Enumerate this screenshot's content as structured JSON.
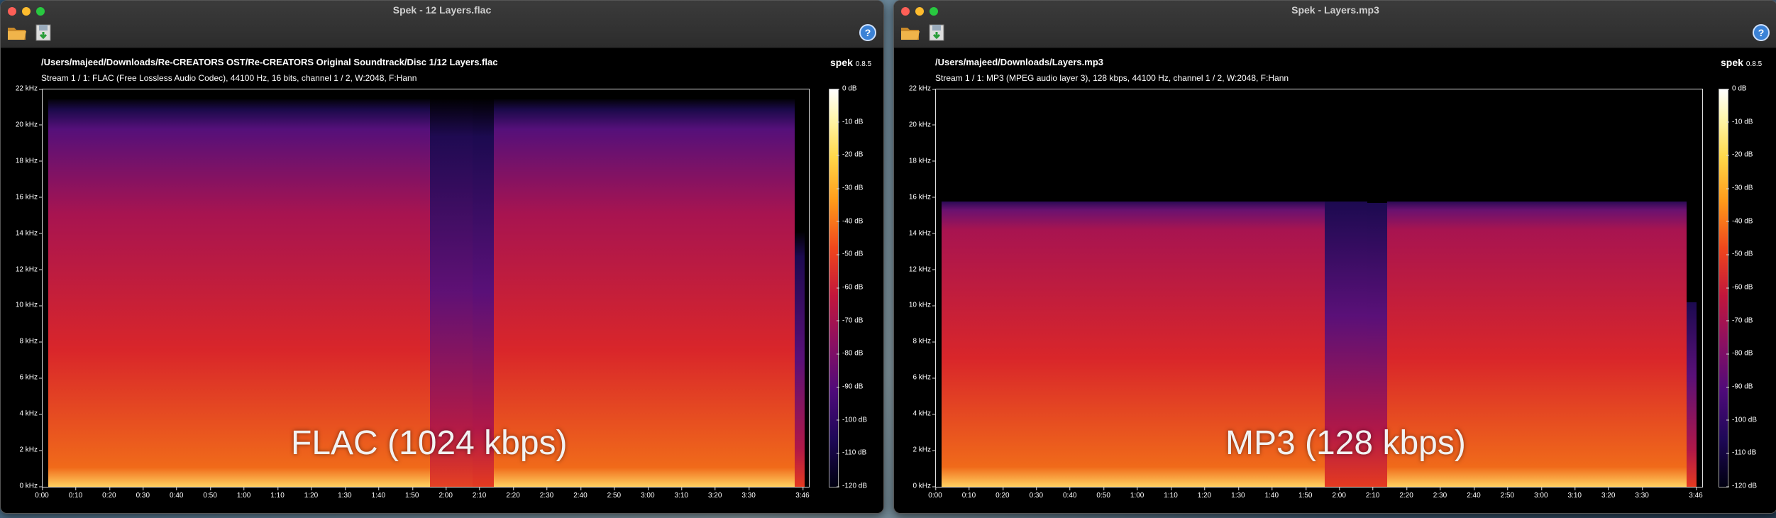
{
  "windows": [
    {
      "title": "Spek - 12 Layers.flac",
      "file_path": "/Users/majeed/Downloads/Re-CREATORS OST/Re-CREATORS Original Soundtrack/Disc 1/12 Layers.flac",
      "stream_info": "Stream 1 / 1: FLAC (Free Lossless Audio Codec), 44100 Hz, 16 bits, channel 1 / 2, W:2048, F:Hann",
      "brand": "spek",
      "version": "0.8.5",
      "overlay_label": "FLAC (1024 kbps)"
    },
    {
      "title": "Spek - Layers.mp3",
      "file_path": "/Users/majeed/Downloads/Layers.mp3",
      "stream_info": "Stream 1 / 1: MP3 (MPEG audio layer 3), 128 kbps, 44100 Hz, channel 1 / 2, W:2048, F:Hann",
      "brand": "spek",
      "version": "0.8.5",
      "overlay_label": "MP3 (128 kbps)"
    }
  ],
  "toolbar": {
    "open_icon": "folder-open-icon",
    "save_icon": "save-icon",
    "help_icon": "help-icon",
    "help_glyph": "?"
  },
  "freq_ticks": [
    "0 kHz",
    "2 kHz",
    "4 kHz",
    "6 kHz",
    "8 kHz",
    "10 kHz",
    "12 kHz",
    "14 kHz",
    "16 kHz",
    "18 kHz",
    "20 kHz",
    "22 kHz"
  ],
  "time_ticks": [
    "0:00",
    "0:10",
    "0:20",
    "0:30",
    "0:40",
    "0:50",
    "1:00",
    "1:10",
    "1:20",
    "1:30",
    "1:40",
    "1:50",
    "2:00",
    "2:10",
    "2:20",
    "2:30",
    "2:40",
    "2:50",
    "3:00",
    "3:10",
    "3:20",
    "3:30",
    "3:46"
  ],
  "time_tick_seconds": [
    0,
    10,
    20,
    30,
    40,
    50,
    60,
    70,
    80,
    90,
    100,
    110,
    120,
    130,
    140,
    150,
    160,
    170,
    180,
    190,
    200,
    210,
    226
  ],
  "duration_seconds": 226,
  "db_ticks": [
    "0 dB",
    "-10 dB",
    "-20 dB",
    "-30 dB",
    "-40 dB",
    "-50 dB",
    "-60 dB",
    "-70 dB",
    "-80 dB",
    "-90 dB",
    "-100 dB",
    "-110 dB",
    "-120 dB"
  ],
  "colors": {
    "spectrum_hot": "#f0461c",
    "spectrum_mid": "#c2163c",
    "spectrum_low": "#4e0a7a",
    "spectrum_floor": "#000010"
  }
}
